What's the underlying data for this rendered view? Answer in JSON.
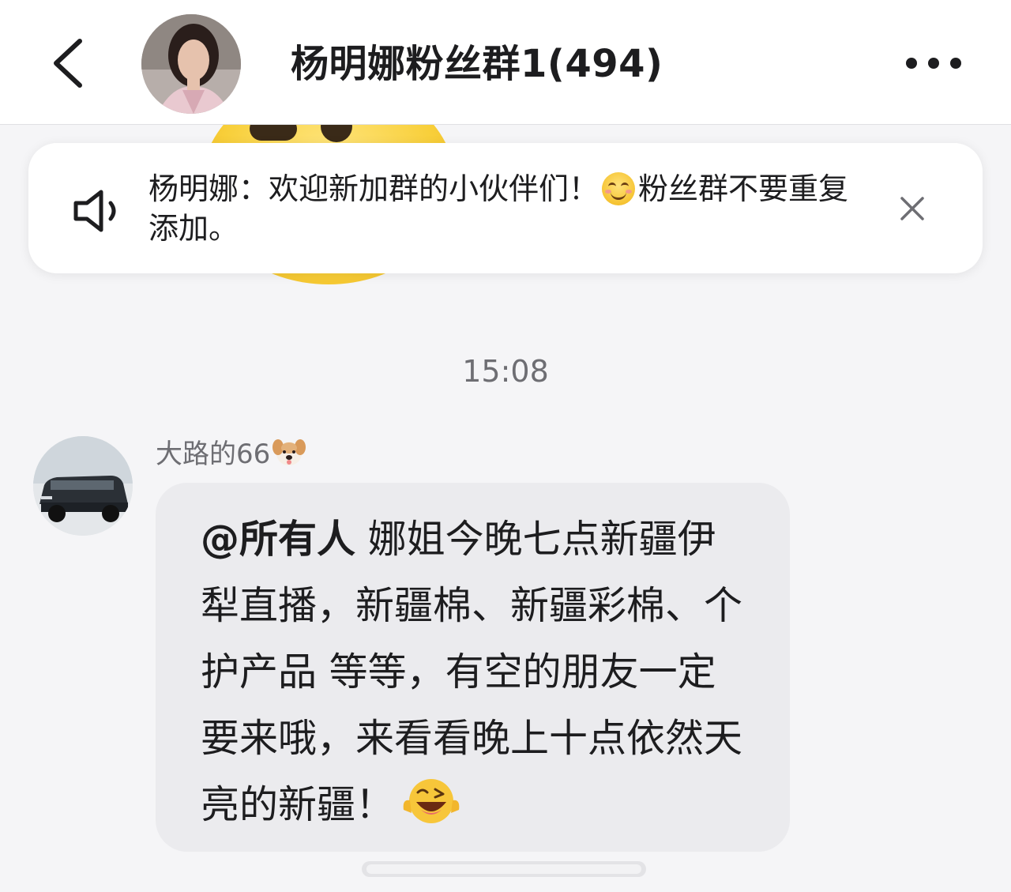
{
  "header": {
    "back_icon": "chevron-left-icon",
    "title": "杨明娜粉丝群1(494)",
    "more_icon": "ellipsis-icon"
  },
  "notice": {
    "icon": "speaker-icon",
    "text_before_emoji": "杨明娜：欢迎新加群的小伙伴们！",
    "emoji": "smiling-face-icon",
    "text_after_emoji": "粉丝群不要重复添加。",
    "close_icon": "close-icon"
  },
  "chat": {
    "timestamp": "15:08",
    "messages": [
      {
        "sender": "大路的66",
        "sender_emoji": "dog-face-icon",
        "mention": "@所有人",
        "text": " 娜姐今晚七点新疆伊犁直播，新疆棉、新疆彩棉、个护产品 等等，有空的朋友一定要来哦，来看看晚上十点依然天亮的新疆！",
        "trailing_emoji": "laughing-winking-face-icon"
      }
    ]
  },
  "colors": {
    "background": "#f5f5f7",
    "bubble": "#ebebee",
    "secondary_text": "#6e6e73"
  }
}
